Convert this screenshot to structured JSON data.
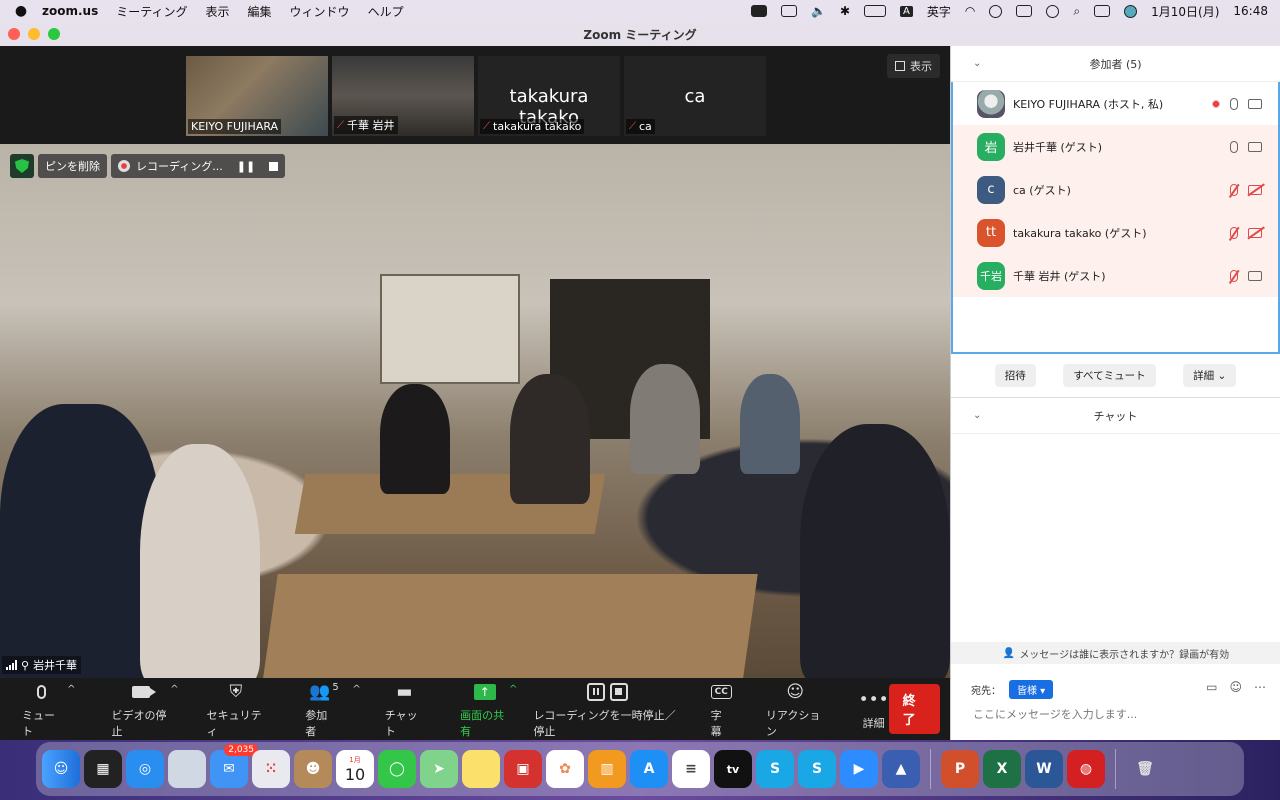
{
  "menubar": {
    "app": "zoom.us",
    "items": [
      "ミーティング",
      "表示",
      "編集",
      "ウィンドウ",
      "ヘルプ"
    ],
    "ime": "A",
    "ime_label": "英字",
    "date": "1月10日(月)",
    "time": "16:48"
  },
  "window": {
    "title": "Zoom ミーティング"
  },
  "thumbnails": [
    {
      "name": "KEIYO FUJIHARA",
      "muted": false,
      "big": ""
    },
    {
      "name": "千華 岩井",
      "muted": true,
      "big": ""
    },
    {
      "name": "takakura takako",
      "muted": true,
      "big": "takakura takako"
    },
    {
      "name": "ca",
      "muted": true,
      "big": "ca"
    }
  ],
  "view_button": "表示",
  "pin": {
    "remove": "ピンを削除",
    "recording": "レコーディング...",
    "pause": "❚❚"
  },
  "active_speaker": "岩井千華",
  "toolbar": {
    "mute": "ミュート",
    "video": "ビデオの停止",
    "security": "セキュリティ",
    "participants": "参加者",
    "participants_count": "5",
    "chat": "チャット",
    "share": "画面の共有",
    "recording": "レコーディングを一時停止／停止",
    "cc": "字幕",
    "cc_icon": "CC",
    "reaction": "リアクション",
    "more": "詳細",
    "end": "終了"
  },
  "participants_panel": {
    "title": "参加者 (5)",
    "rows": [
      {
        "avatar": "",
        "name": "KEIYO FUJIHARA (ホスト, 私)",
        "color": "#9aa",
        "mic_off": false,
        "cam_off": false,
        "rec": true
      },
      {
        "avatar": "岩",
        "name": "岩井千華 (ゲスト)",
        "color": "#27ae60",
        "mic_off": false,
        "cam_off": false,
        "rec": false
      },
      {
        "avatar": "c",
        "name": "ca (ゲスト)",
        "color": "#3d5a80",
        "mic_off": true,
        "cam_off": true,
        "rec": false
      },
      {
        "avatar": "tt",
        "name": "takakura takako (ゲスト)",
        "color": "#d9532c",
        "mic_off": true,
        "cam_off": true,
        "rec": false
      },
      {
        "avatar": "千岩",
        "name": "千華 岩井 (ゲスト)",
        "color": "#27ae60",
        "mic_off": true,
        "cam_off": false,
        "rec": false
      }
    ],
    "invite": "招待",
    "mute_all": "すべてミュート",
    "more": "詳細"
  },
  "chat_panel": {
    "title": "チャット",
    "notice": "メッセージは誰に表示されますか？録画が有効",
    "to_label": "宛先：",
    "to_value": "皆様",
    "placeholder": "ここにメッセージを入力します..."
  },
  "dock": {
    "mail_badge": "2,035",
    "cal_month": "1月",
    "cal_day": "10",
    "tv": "tv",
    "apps": [
      "finder",
      "mission-control",
      "safari",
      "preview",
      "mail",
      "launchpad",
      "contacts",
      "calendar",
      "messages",
      "maps",
      "notes",
      "photo-booth",
      "photos",
      "books",
      "app-store",
      "reminders",
      "apple-tv",
      "skype",
      "skype-2",
      "zoom",
      "keynote",
      "powerpoint",
      "excel",
      "word",
      "trend-micro",
      "trash"
    ]
  }
}
